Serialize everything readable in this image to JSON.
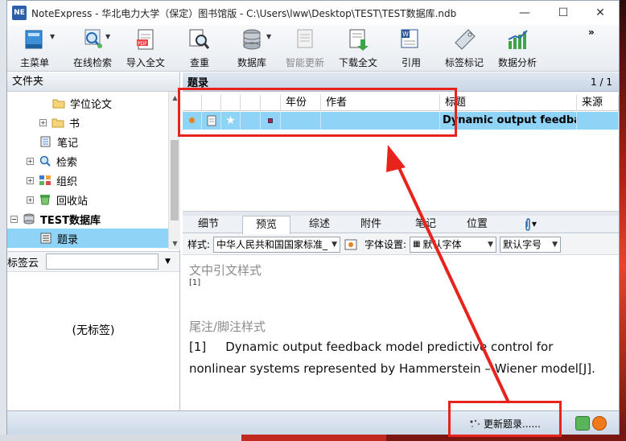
{
  "window": {
    "title": "NoteExpress - 华北电力大学（保定）图书馆版 - C:\\Users\\lww\\Desktop\\TEST\\TEST数据库.ndb",
    "app_icon_text": "NE",
    "minimize": "—",
    "maximize": "☐",
    "close": "✕"
  },
  "toolbar": {
    "items": [
      {
        "label": "主菜单",
        "icon": "main-menu-icon",
        "has_dropdown": true
      },
      {
        "label": "在线检索",
        "icon": "online-search-icon",
        "has_dropdown": true
      },
      {
        "label": "导入全文",
        "icon": "import-fulltext-icon"
      },
      {
        "label": "查重",
        "icon": "duplicate-check-icon"
      },
      {
        "label": "数据库",
        "icon": "database-icon",
        "has_dropdown": true
      },
      {
        "label": "智能更新",
        "icon": "smart-update-icon",
        "disabled": true
      },
      {
        "label": "下载全文",
        "icon": "download-fulltext-icon"
      },
      {
        "label": "引用",
        "icon": "cite-icon"
      },
      {
        "label": "标签标记",
        "icon": "tag-mark-icon"
      },
      {
        "label": "数据分析",
        "icon": "data-analysis-icon"
      }
    ],
    "overflow": "»"
  },
  "left_pane": {
    "header": "文件夹",
    "tree": [
      {
        "label": "学位论文",
        "icon": "folder-icon",
        "expander": ""
      },
      {
        "label": "书",
        "icon": "folder-icon",
        "expander": "+"
      },
      {
        "label": "笔记",
        "icon": "notes-icon",
        "expander": ""
      },
      {
        "label": "检索",
        "icon": "search-icon",
        "expander": "+"
      },
      {
        "label": "组织",
        "icon": "organize-icon",
        "expander": "+"
      },
      {
        "label": "回收站",
        "icon": "recycle-bin-icon",
        "expander": "+"
      },
      {
        "label": "TEST数据库",
        "icon": "database-icon",
        "expander": "−",
        "bold": true
      },
      {
        "label": "题录",
        "icon": "records-icon",
        "expander": "",
        "selected": true
      }
    ],
    "tag_cloud_label": "标签云",
    "tag_cloud_value": "",
    "no_tags": "(无标签)"
  },
  "list": {
    "title": "题录",
    "page": "1 / 1",
    "columns": [
      "",
      "",
      "",
      "",
      "",
      "年份",
      "作者",
      "标题",
      "来源"
    ],
    "rows": [
      {
        "year": "",
        "author": "",
        "title": "Dynamic output feedba.",
        "source": ""
      }
    ]
  },
  "tabs": {
    "items": [
      "细节",
      "预览",
      "综述",
      "附件",
      "笔记",
      "位置"
    ],
    "active": "预览",
    "attach_icon": "paperclip-icon"
  },
  "preview_bar": {
    "style_label": "样式:",
    "style_value": "中华人民共和国国家标准_",
    "font_setting_label": "字体设置:",
    "font_value": "默认字体",
    "size_value": "默认字号"
  },
  "preview": {
    "intext_label": "文中引文样式",
    "intext_value": "[1]",
    "footnote_label": "尾注/脚注样式",
    "ref_number": "[1]",
    "ref_line1": "Dynamic output feedback model predictive control for",
    "ref_line2": "nonlinear systems represented by Hammerstein – Wiener model[J]."
  },
  "statusbar": {
    "update_text": "更新题录......"
  },
  "colors": {
    "selection": "#8fd3f6",
    "annotation_red": "#e8231c",
    "header_blue": "#c9d6e5"
  }
}
